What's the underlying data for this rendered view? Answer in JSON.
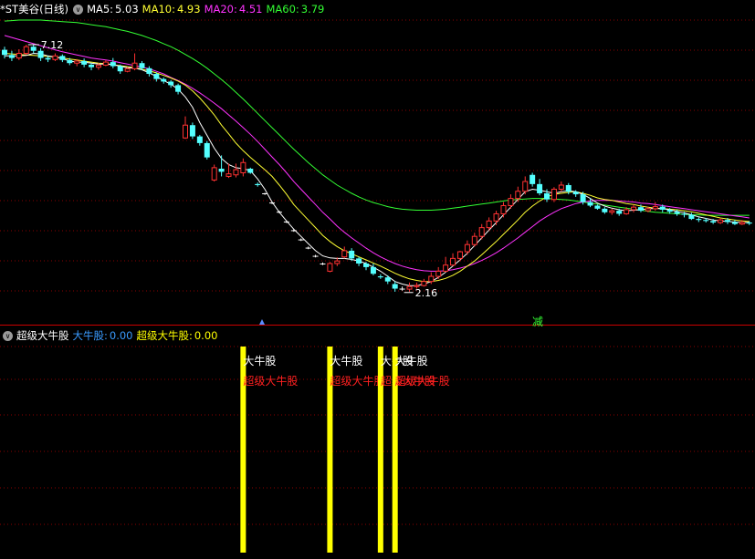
{
  "top_legend": {
    "stock_title": "*ST美谷(日线)",
    "ma": [
      {
        "label": "MA5:",
        "value": "5.03",
        "color": "#ffffff"
      },
      {
        "label": "MA10:",
        "value": "4.93",
        "color": "#ffff33"
      },
      {
        "label": "MA20:",
        "value": "4.51",
        "color": "#ff33ff"
      },
      {
        "label": "MA60:",
        "value": "3.79",
        "color": "#33ff33"
      }
    ]
  },
  "bottom_legend": {
    "indicator_name": "超级大牛股",
    "items": [
      {
        "label": "大牛股:",
        "value": "0.00",
        "color": "#3a9bff"
      },
      {
        "label": "超级大牛股:",
        "value": "0.00",
        "color": "#ffff00"
      }
    ]
  },
  "annotations": {
    "high_label": "7.12",
    "low_label": "2.16",
    "reduce_label": "减"
  },
  "signals": {
    "label_white": "大牛股",
    "label_red": "超级大牛股",
    "bars": [
      {
        "candle_index": 33
      },
      {
        "candle_index": 45
      },
      {
        "candle_index": 52
      },
      {
        "candle_index": 54
      }
    ]
  },
  "colors": {
    "up": "#ff3232",
    "down": "#54ffff",
    "flat": "#ffffff",
    "ma5": "#ffffff",
    "ma10": "#ffff33",
    "ma20": "#ff33ff",
    "ma60": "#33ff33",
    "signal_bar": "#ffff00",
    "grid": "#8b0000"
  },
  "chart_data": {
    "type": "candlestick",
    "y_range": [
      1.8,
      7.6
    ],
    "candles": [
      [
        7.02,
        6.92,
        7.08,
        6.85
      ],
      [
        6.92,
        6.86,
        7.0,
        6.8
      ],
      [
        6.86,
        6.95,
        7.03,
        6.82
      ],
      [
        6.95,
        7.08,
        7.12,
        6.92
      ],
      [
        7.08,
        7.0,
        7.12,
        6.95
      ],
      [
        7.0,
        6.86,
        7.05,
        6.8
      ],
      [
        6.86,
        6.83,
        6.9,
        6.78
      ],
      [
        6.83,
        6.9,
        6.95,
        6.8
      ],
      [
        6.9,
        6.82,
        6.93,
        6.78
      ],
      [
        6.82,
        6.76,
        6.86,
        6.72
      ],
      [
        6.76,
        6.8,
        6.84,
        6.7
      ],
      [
        6.8,
        6.73,
        6.85,
        6.68
      ],
      [
        6.73,
        6.68,
        6.76,
        6.62
      ],
      [
        6.68,
        6.72,
        6.76,
        6.63
      ],
      [
        6.72,
        6.78,
        6.82,
        6.7
      ],
      [
        6.78,
        6.7,
        6.86,
        6.66
      ],
      [
        6.7,
        6.6,
        6.73,
        6.55
      ],
      [
        6.6,
        6.65,
        6.68,
        6.58
      ],
      [
        6.65,
        6.76,
        6.95,
        6.62
      ],
      [
        6.76,
        6.66,
        6.8,
        6.62
      ],
      [
        6.66,
        6.55,
        6.7,
        6.5
      ],
      [
        6.55,
        6.45,
        6.58,
        6.4
      ],
      [
        6.45,
        6.4,
        6.48,
        6.36
      ],
      [
        6.4,
        6.33,
        6.43,
        6.28
      ],
      [
        6.33,
        6.2,
        6.36,
        6.15
      ],
      [
        5.3,
        5.55,
        5.72,
        5.28
      ],
      [
        5.55,
        5.33,
        5.6,
        5.28
      ],
      [
        5.33,
        5.2,
        5.36,
        5.15
      ],
      [
        5.2,
        4.92,
        5.24,
        4.88
      ],
      [
        4.48,
        4.72,
        4.78,
        4.45
      ],
      [
        4.7,
        4.64,
        4.96,
        4.55
      ],
      [
        4.55,
        4.6,
        4.8,
        4.52
      ],
      [
        4.58,
        4.68,
        4.8,
        4.53
      ],
      [
        4.62,
        4.82,
        4.9,
        4.55
      ],
      [
        4.7,
        4.62,
        4.72,
        4.6
      ],
      [
        4.4,
        4.38,
        4.43,
        4.35
      ],
      [
        4.22,
        4.21,
        4.23,
        4.19
      ],
      [
        4.04,
        4.03,
        4.06,
        4.01
      ],
      [
        3.86,
        3.85,
        3.88,
        3.83
      ],
      [
        3.67,
        3.66,
        3.69,
        3.64
      ],
      [
        3.5,
        3.49,
        3.52,
        3.47
      ],
      [
        3.32,
        3.31,
        3.34,
        3.29
      ],
      [
        3.16,
        3.15,
        3.18,
        3.13
      ],
      [
        3.0,
        2.99,
        3.02,
        2.97
      ],
      [
        2.85,
        2.84,
        2.87,
        2.82
      ],
      [
        2.7,
        2.85,
        2.88,
        2.68
      ],
      [
        2.85,
        2.9,
        2.97,
        2.8
      ],
      [
        2.98,
        3.1,
        3.18,
        2.95
      ],
      [
        3.1,
        2.95,
        3.15,
        2.9
      ],
      [
        2.95,
        2.85,
        2.98,
        2.8
      ],
      [
        2.85,
        2.78,
        2.88,
        2.72
      ],
      [
        2.78,
        2.65,
        2.85,
        2.62
      ],
      [
        2.6,
        2.58,
        2.64,
        2.55
      ],
      [
        2.58,
        2.5,
        2.62,
        2.45
      ],
      [
        2.45,
        2.36,
        2.5,
        2.3
      ],
      [
        2.36,
        2.35,
        2.4,
        2.32
      ],
      [
        2.35,
        2.4,
        2.48,
        2.3
      ],
      [
        2.4,
        2.42,
        2.48,
        2.36
      ],
      [
        2.42,
        2.5,
        2.55,
        2.4
      ],
      [
        2.5,
        2.6,
        2.68,
        2.45
      ],
      [
        2.6,
        2.7,
        2.78,
        2.55
      ],
      [
        2.7,
        2.82,
        2.98,
        2.68
      ],
      [
        2.82,
        2.95,
        3.05,
        2.8
      ],
      [
        2.95,
        3.08,
        3.1,
        2.9
      ],
      [
        3.08,
        3.22,
        3.3,
        3.02
      ],
      [
        3.22,
        3.38,
        3.45,
        3.18
      ],
      [
        3.38,
        3.55,
        3.62,
        3.32
      ],
      [
        3.55,
        3.68,
        3.75,
        3.5
      ],
      [
        3.68,
        3.82,
        3.88,
        3.6
      ],
      [
        3.82,
        3.98,
        4.05,
        3.75
      ],
      [
        3.98,
        4.12,
        4.2,
        3.92
      ],
      [
        4.12,
        4.26,
        4.35,
        4.05
      ],
      [
        4.26,
        4.45,
        4.55,
        4.2
      ],
      [
        4.58,
        4.4,
        4.62,
        4.35
      ],
      [
        4.4,
        4.22,
        4.5,
        4.18
      ],
      [
        4.22,
        4.1,
        4.3,
        4.05
      ],
      [
        4.1,
        4.3,
        4.34,
        4.05
      ],
      [
        4.3,
        4.38,
        4.45,
        4.25
      ],
      [
        4.38,
        4.25,
        4.42,
        4.2
      ],
      [
        4.25,
        4.2,
        4.28,
        4.15
      ],
      [
        4.2,
        4.05,
        4.25,
        4.0
      ],
      [
        4.05,
        3.98,
        4.12,
        3.95
      ],
      [
        3.98,
        3.92,
        4.0,
        3.9
      ],
      [
        3.92,
        3.85,
        3.95,
        3.82
      ],
      [
        3.85,
        3.88,
        3.92,
        3.8
      ],
      [
        3.88,
        3.82,
        3.92,
        3.78
      ],
      [
        3.82,
        3.9,
        3.95,
        3.8
      ],
      [
        3.9,
        3.95,
        4.0,
        3.85
      ],
      [
        3.95,
        3.88,
        4.0,
        3.85
      ],
      [
        3.88,
        3.92,
        3.96,
        3.85
      ],
      [
        3.92,
        3.96,
        4.05,
        3.88
      ],
      [
        3.96,
        3.9,
        4.0,
        3.85
      ],
      [
        3.9,
        3.86,
        3.93,
        3.82
      ],
      [
        3.86,
        3.82,
        3.9,
        3.78
      ],
      [
        3.82,
        3.8,
        3.86,
        3.75
      ],
      [
        3.8,
        3.72,
        3.84,
        3.7
      ],
      [
        3.72,
        3.7,
        3.75,
        3.66
      ],
      [
        3.7,
        3.68,
        3.74,
        3.65
      ],
      [
        3.68,
        3.65,
        3.72,
        3.62
      ],
      [
        3.65,
        3.7,
        3.74,
        3.62
      ],
      [
        3.7,
        3.66,
        3.74,
        3.62
      ],
      [
        3.66,
        3.62,
        3.7,
        3.6
      ],
      [
        3.62,
        3.65,
        3.7,
        3.6
      ],
      [
        3.65,
        3.63,
        3.68,
        3.6
      ]
    ],
    "ma5": [
      6.9,
      6.9,
      6.9,
      6.91,
      6.95,
      6.94,
      6.9,
      6.88,
      6.85,
      6.8,
      6.78,
      6.78,
      6.76,
      6.74,
      6.74,
      6.73,
      6.7,
      6.67,
      6.66,
      6.63,
      6.57,
      6.5,
      6.42,
      6.35,
      6.25,
      6.1,
      5.9,
      5.6,
      5.35,
      5.1,
      4.9,
      4.78,
      4.72,
      4.7,
      4.66,
      4.5,
      4.3,
      4.05,
      3.85,
      3.68,
      3.52,
      3.38,
      3.24,
      3.1,
      3.0,
      2.96,
      2.95,
      2.95,
      2.93,
      2.9,
      2.85,
      2.78,
      2.7,
      2.6,
      2.5,
      2.45,
      2.42,
      2.42,
      2.45,
      2.5,
      2.58,
      2.68,
      2.8,
      2.92,
      3.05,
      3.2,
      3.35,
      3.5,
      3.65,
      3.8,
      3.95,
      4.1,
      4.25,
      4.3,
      4.28,
      4.25,
      4.22,
      4.25,
      4.27,
      4.25,
      4.2,
      4.12,
      4.03,
      3.97,
      3.93,
      3.9,
      3.88,
      3.89,
      3.9,
      3.92,
      3.92,
      3.92,
      3.9,
      3.87,
      3.84,
      3.8,
      3.76,
      3.73,
      3.7,
      3.68,
      3.67,
      3.66,
      3.65,
      3.65
    ],
    "ma10": [
      6.95,
      6.94,
      6.93,
      6.92,
      6.91,
      6.9,
      6.89,
      6.88,
      6.86,
      6.84,
      6.82,
      6.8,
      6.78,
      6.76,
      6.75,
      6.73,
      6.71,
      6.69,
      6.67,
      6.64,
      6.61,
      6.57,
      6.52,
      6.47,
      6.41,
      6.33,
      6.22,
      6.08,
      5.92,
      5.75,
      5.55,
      5.38,
      5.2,
      5.05,
      4.92,
      4.8,
      4.68,
      4.55,
      4.38,
      4.2,
      4.0,
      3.85,
      3.7,
      3.55,
      3.4,
      3.28,
      3.18,
      3.1,
      3.04,
      2.98,
      2.92,
      2.86,
      2.8,
      2.73,
      2.66,
      2.6,
      2.55,
      2.52,
      2.5,
      2.5,
      2.52,
      2.56,
      2.62,
      2.7,
      2.8,
      2.9,
      3.02,
      3.15,
      3.28,
      3.42,
      3.56,
      3.7,
      3.85,
      3.97,
      4.07,
      4.15,
      4.2,
      4.22,
      4.24,
      4.25,
      4.22,
      4.18,
      4.13,
      4.1,
      4.08,
      4.05,
      4.02,
      4.0,
      3.97,
      3.95,
      3.93,
      3.92,
      3.91,
      3.9,
      3.88,
      3.86,
      3.83,
      3.8,
      3.77,
      3.74,
      3.72,
      3.7,
      3.68,
      3.67
    ],
    "ma20": [
      7.3,
      7.26,
      7.22,
      7.18,
      7.14,
      7.1,
      7.06,
      7.02,
      6.98,
      6.95,
      6.92,
      6.89,
      6.86,
      6.84,
      6.82,
      6.8,
      6.77,
      6.74,
      6.71,
      6.68,
      6.65,
      6.6,
      6.55,
      6.48,
      6.42,
      6.35,
      6.27,
      6.18,
      6.08,
      5.98,
      5.87,
      5.75,
      5.63,
      5.5,
      5.37,
      5.23,
      5.08,
      4.93,
      4.78,
      4.62,
      4.45,
      4.3,
      4.15,
      4.0,
      3.85,
      3.72,
      3.58,
      3.46,
      3.35,
      3.25,
      3.15,
      3.06,
      2.98,
      2.91,
      2.85,
      2.8,
      2.76,
      2.73,
      2.71,
      2.7,
      2.7,
      2.71,
      2.73,
      2.76,
      2.8,
      2.85,
      2.91,
      2.98,
      3.06,
      3.15,
      3.25,
      3.35,
      3.46,
      3.57,
      3.68,
      3.77,
      3.85,
      3.92,
      3.97,
      4.02,
      4.05,
      4.07,
      4.08,
      4.08,
      4.08,
      4.07,
      4.06,
      4.05,
      4.03,
      4.02,
      4.0,
      3.98,
      3.96,
      3.94,
      3.92,
      3.9,
      3.88,
      3.86,
      3.84,
      3.82,
      3.8,
      3.78,
      3.76,
      3.74
    ],
    "ma60": [
      7.58,
      7.59,
      7.6,
      7.6,
      7.6,
      7.6,
      7.59,
      7.58,
      7.57,
      7.56,
      7.55,
      7.53,
      7.51,
      7.49,
      7.47,
      7.44,
      7.41,
      7.38,
      7.34,
      7.3,
      7.25,
      7.2,
      7.14,
      7.08,
      7.01,
      6.93,
      6.85,
      6.76,
      6.66,
      6.55,
      6.44,
      6.32,
      6.19,
      6.06,
      5.92,
      5.78,
      5.64,
      5.5,
      5.36,
      5.22,
      5.08,
      4.95,
      4.82,
      4.7,
      4.58,
      4.48,
      4.38,
      4.3,
      4.22,
      4.15,
      4.09,
      4.04,
      4.0,
      3.96,
      3.93,
      3.91,
      3.9,
      3.89,
      3.89,
      3.89,
      3.9,
      3.91,
      3.93,
      3.95,
      3.97,
      3.99,
      4.01,
      4.03,
      4.05,
      4.07,
      4.09,
      4.1,
      4.11,
      4.12,
      4.12,
      4.12,
      4.11,
      4.1,
      4.09,
      4.07,
      4.05,
      4.03,
      4.01,
      3.99,
      3.97,
      3.95,
      3.93,
      3.91,
      3.89,
      3.87,
      3.85,
      3.84,
      3.83,
      3.82,
      3.81,
      3.8,
      3.8,
      3.79,
      3.79,
      3.79,
      3.79,
      3.79,
      3.79,
      3.79
    ]
  }
}
